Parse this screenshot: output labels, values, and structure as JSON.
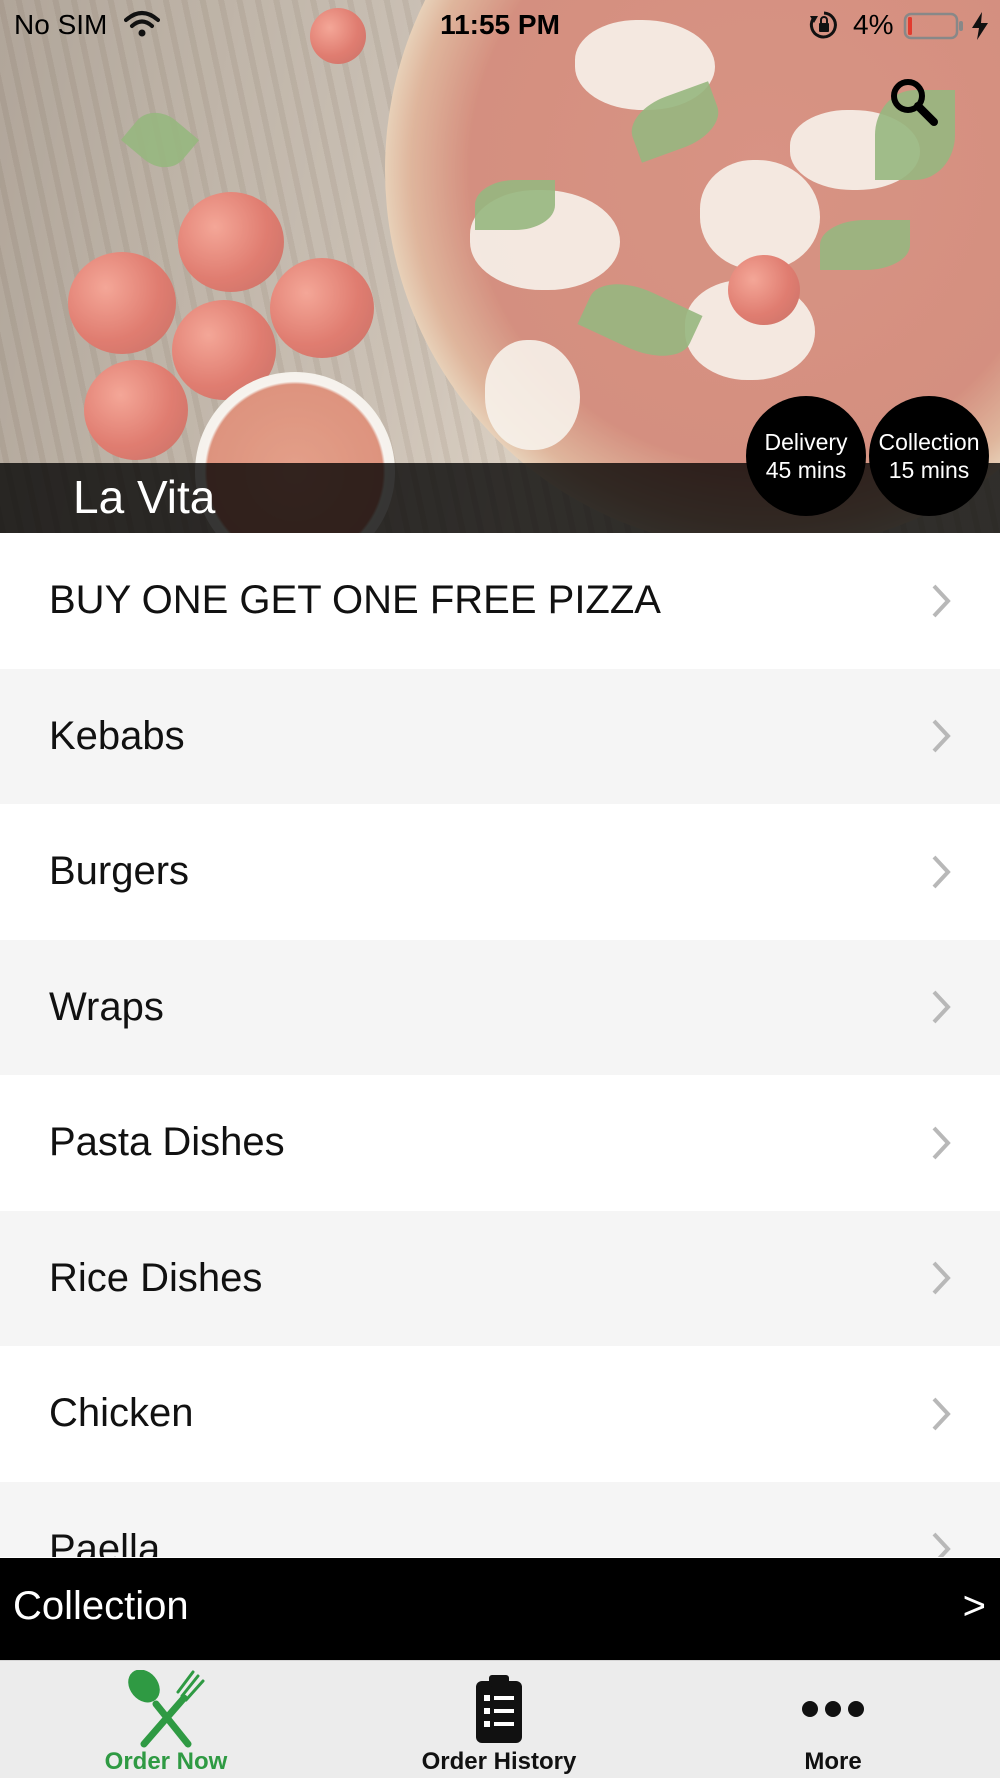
{
  "status_bar": {
    "carrier": "No SIM",
    "time": "11:55 PM",
    "battery_percent": "4%"
  },
  "hero": {
    "restaurant_name": "La Vita",
    "search_icon": "search-icon",
    "delivery": {
      "label": "Delivery",
      "time": "45 mins"
    },
    "collection": {
      "label": "Collection",
      "time": "15 mins"
    }
  },
  "categories": [
    "BUY ONE GET ONE FREE PIZZA",
    "Kebabs",
    "Burgers",
    "Wraps",
    "Pasta Dishes",
    "Rice Dishes",
    "Chicken",
    "Paella"
  ],
  "order_mode_bar": {
    "label": "Collection",
    "arrow": ">"
  },
  "tab_bar": {
    "tabs": [
      {
        "label": "Order Now",
        "icon": "fork-knife-icon",
        "active": true
      },
      {
        "label": "Order History",
        "icon": "clipboard-list-icon",
        "active": false
      },
      {
        "label": "More",
        "icon": "more-dots-icon",
        "active": false
      }
    ]
  },
  "colors": {
    "accent_green": "#2f9a43",
    "bar_black": "#000000",
    "row_alt": "#f5f5f5"
  }
}
